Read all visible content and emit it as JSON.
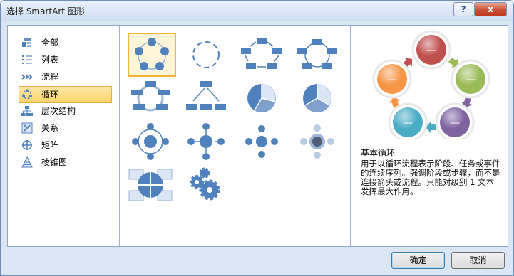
{
  "window": {
    "title": "选择 SmartArt 图形",
    "help_label": "?",
    "close_label": "x"
  },
  "categories": [
    {
      "label": "全部",
      "icon": "all-icon"
    },
    {
      "label": "列表",
      "icon": "list-icon"
    },
    {
      "label": "流程",
      "icon": "process-icon"
    },
    {
      "label": "循环",
      "icon": "cycle-icon",
      "selected": true
    },
    {
      "label": "层次结构",
      "icon": "hierarchy-icon"
    },
    {
      "label": "关系",
      "icon": "relationship-icon"
    },
    {
      "label": "矩阵",
      "icon": "matrix-icon"
    },
    {
      "label": "棱锥图",
      "icon": "pyramid-icon"
    }
  ],
  "gallery": {
    "selected_index": 0,
    "item_count": 14
  },
  "preview": {
    "title": "基本循环",
    "description": "用于以循环流程表示阶段、任务或事件的连续序列。强调阶段或步骤，而不是连接箭头或流程。只能对级别 1 文本发挥最大作用。",
    "circle_colors": [
      "#c0504d",
      "#9bbb59",
      "#8064a2",
      "#4bacc6",
      "#f79646"
    ],
    "shape_label": "—"
  },
  "buttons": {
    "ok": "确定",
    "cancel": "取消"
  },
  "colors": {
    "accent": "#4f81bd",
    "selection": "#fbd46b"
  }
}
